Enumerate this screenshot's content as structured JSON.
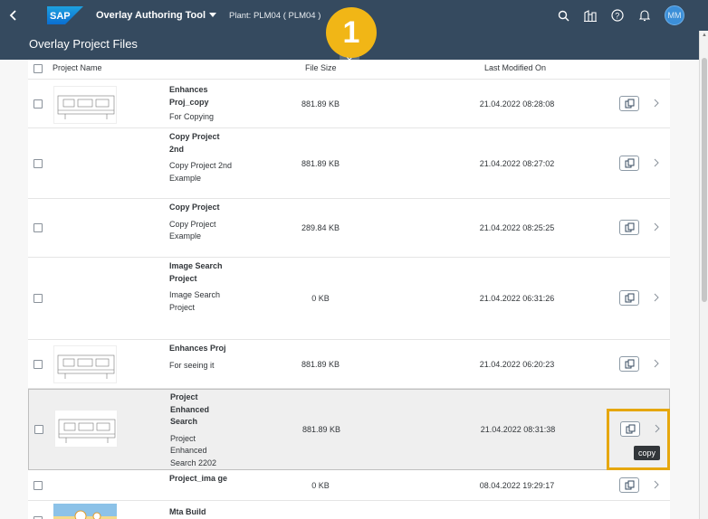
{
  "shell": {
    "logo_text": "SAP",
    "app_title": "Overlay Authoring Tool",
    "plant": "Plant: PLM04 ( PLM04 )",
    "avatar_initials": "MM"
  },
  "page": {
    "title": "Overlay Project Files",
    "step_badge": "1"
  },
  "table": {
    "columns": {
      "name": "Project Name",
      "size": "File Size",
      "modified": "Last Modified On"
    },
    "rows": [
      {
        "name": "Enhances Proj_copy",
        "desc": "For Copying",
        "size": "881.89 KB",
        "date": "21.04.2022 08:28:08"
      },
      {
        "name": "Copy Project 2nd",
        "desc": "Copy Project 2nd Example",
        "size": "881.89 KB",
        "date": "21.04.2022 08:27:02"
      },
      {
        "name": "Copy Project",
        "desc": "Copy Project Example",
        "size": "289.84 KB",
        "date": "21.04.2022 08:25:25"
      },
      {
        "name": "Image Search Project",
        "desc": "Image Search Project",
        "size": "0 KB",
        "date": "21.04.2022 06:31:26"
      },
      {
        "name": "Enhances Proj",
        "desc": "For seeing it",
        "size": "881.89 KB",
        "date": "21.04.2022 06:20:23"
      },
      {
        "name": "Project Enhanced Search",
        "desc": "Project Enhanced Search 2202",
        "size": "881.89 KB",
        "date": "21.04.2022 08:31:38"
      },
      {
        "name": "Project_ima ge",
        "desc": "",
        "size": "0 KB",
        "date": "08.04.2022 19:29:17"
      },
      {
        "name": "Mta Build",
        "desc": "",
        "size": "",
        "date": ""
      }
    ]
  },
  "tooltip": "copy",
  "colors": {
    "shell_bg": "#354a5f",
    "accent_badge": "#f1b616",
    "highlight_border": "#e6a70e"
  }
}
